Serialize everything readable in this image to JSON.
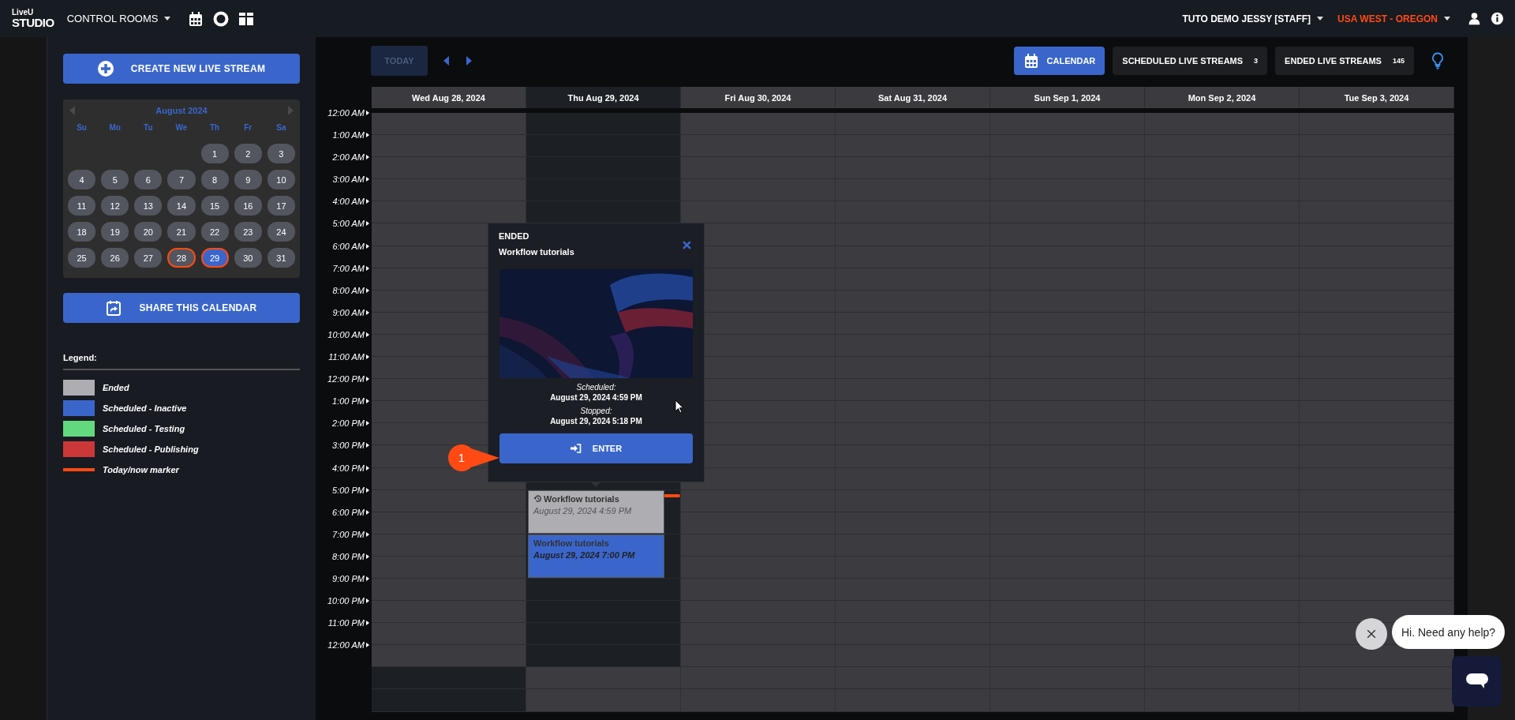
{
  "topbar": {
    "logo_top": "LiveU",
    "logo_bottom": "STUDIO",
    "menu": "CONTROL ROOMS",
    "user": "TUTO DEMO JESSY [STAFF]",
    "region": "USA WEST - OREGON"
  },
  "sidebar": {
    "create_button": "CREATE NEW LIVE STREAM",
    "mini_calendar": {
      "month": "August 2024",
      "weekdays": [
        "Su",
        "Mo",
        "Tu",
        "We",
        "Th",
        "Fr",
        "Sa"
      ],
      "weeks": [
        [
          {
            "label": "1",
            "selected": false,
            "outlined": false
          },
          {
            "label": "2",
            "selected": false,
            "outlined": false
          },
          {
            "label": "3",
            "selected": false,
            "outlined": false
          }
        ],
        [
          {
            "label": "4",
            "selected": false,
            "outlined": false
          },
          {
            "label": "5",
            "selected": false,
            "outlined": false
          },
          {
            "label": "6",
            "selected": false,
            "outlined": false
          },
          {
            "label": "7",
            "selected": false,
            "outlined": false
          },
          {
            "label": "8",
            "selected": false,
            "outlined": false
          },
          {
            "label": "9",
            "selected": false,
            "outlined": false
          },
          {
            "label": "10",
            "selected": false,
            "outlined": false
          }
        ],
        [
          {
            "label": "11",
            "selected": false,
            "outlined": false
          },
          {
            "label": "12",
            "selected": false,
            "outlined": false
          },
          {
            "label": "13",
            "selected": false,
            "outlined": false
          },
          {
            "label": "14",
            "selected": false,
            "outlined": false
          },
          {
            "label": "15",
            "selected": false,
            "outlined": false
          },
          {
            "label": "16",
            "selected": false,
            "outlined": false
          },
          {
            "label": "17",
            "selected": false,
            "outlined": false
          }
        ],
        [
          {
            "label": "18",
            "selected": false,
            "outlined": false
          },
          {
            "label": "19",
            "selected": false,
            "outlined": false
          },
          {
            "label": "20",
            "selected": false,
            "outlined": false
          },
          {
            "label": "21",
            "selected": false,
            "outlined": false
          },
          {
            "label": "22",
            "selected": false,
            "outlined": false
          },
          {
            "label": "23",
            "selected": false,
            "outlined": false
          },
          {
            "label": "24",
            "selected": false,
            "outlined": false
          }
        ],
        [
          {
            "label": "25",
            "selected": false,
            "outlined": false
          },
          {
            "label": "26",
            "selected": false,
            "outlined": false
          },
          {
            "label": "27",
            "selected": false,
            "outlined": false
          },
          {
            "label": "28",
            "selected": false,
            "outlined": true
          },
          {
            "label": "29",
            "selected": true,
            "outlined": true
          },
          {
            "label": "30",
            "selected": false,
            "outlined": false
          },
          {
            "label": "31",
            "selected": false,
            "outlined": false
          }
        ]
      ]
    },
    "share_button": "SHARE THIS CALENDAR",
    "legend": {
      "title": "Legend:",
      "items": [
        {
          "kind": "swatch",
          "color": "#aeadb2",
          "label": "Ended"
        },
        {
          "kind": "swatch",
          "color": "#3a66cc",
          "label": "Scheduled - Inactive"
        },
        {
          "kind": "swatch",
          "color": "#62d97f",
          "label": "Scheduled - Testing"
        },
        {
          "kind": "swatch",
          "color": "#cc383a",
          "label": "Scheduled - Publishing"
        },
        {
          "kind": "line",
          "color": "#ff4a14",
          "label": "Today/now marker"
        }
      ]
    }
  },
  "toolbar": {
    "today": {
      "label": "TODAY",
      "disabled": true
    },
    "views": [
      {
        "label": "CALENDAR",
        "selected": true
      },
      {
        "label": "SCHEDULED LIVE STREAMS",
        "count": "3",
        "selected": false
      },
      {
        "label": "ENDED LIVE STREAMS",
        "count": "145",
        "selected": false
      }
    ]
  },
  "calendar": {
    "days": [
      {
        "label": "Wed Aug 28, 2024",
        "selected": false
      },
      {
        "label": "Thu Aug 29, 2024",
        "selected": true
      },
      {
        "label": "Fri Aug 30, 2024",
        "selected": false
      },
      {
        "label": "Sat Aug 31, 2024",
        "selected": false
      },
      {
        "label": "Sun Sep 1, 2024",
        "selected": false
      },
      {
        "label": "Mon Sep 2, 2024",
        "selected": false
      },
      {
        "label": "Tue Sep 3, 2024",
        "selected": false
      }
    ],
    "times": [
      {
        "label": "12:00 AM",
        "now": false
      },
      {
        "label": "1:00 AM",
        "now": false
      },
      {
        "label": "2:00 AM",
        "now": false
      },
      {
        "label": "3:00 AM",
        "now": false
      },
      {
        "label": "4:00 AM",
        "now": false
      },
      {
        "label": "5:00 AM",
        "now": false
      },
      {
        "label": "6:00 AM",
        "now": false
      },
      {
        "label": "7:00 AM",
        "now": false
      },
      {
        "label": "8:00 AM",
        "now": false
      },
      {
        "label": "9:00 AM",
        "now": false
      },
      {
        "label": "10:00 AM",
        "now": false
      },
      {
        "label": "11:00 AM",
        "now": false
      },
      {
        "label": "12:00 PM",
        "now": false
      },
      {
        "label": "1:00 PM",
        "now": false
      },
      {
        "label": "2:00 PM",
        "now": false
      },
      {
        "label": "3:00 PM",
        "now": false
      },
      {
        "label": "4:00 PM",
        "now": false
      },
      {
        "label": "5:00 PM",
        "now": true,
        "events": [
          {
            "kind": "ended",
            "color": "#aeadb2",
            "title": "Workflow tutorials",
            "time": "August 29, 2024 4:59 PM"
          }
        ]
      },
      {
        "label": "6:00 PM",
        "now": false
      },
      {
        "label": "7:00 PM",
        "now": false,
        "events": [
          {
            "kind": "scheduled",
            "color": "#3a66cc",
            "title": "Workflow tutorials",
            "time": "August 29, 2024 7:00 PM"
          }
        ]
      },
      {
        "label": "8:00 PM",
        "now": false
      },
      {
        "label": "9:00 PM",
        "now": false
      },
      {
        "label": "10:00 PM",
        "now": false
      },
      {
        "label": "11:00 PM",
        "now": false
      },
      {
        "label": "12:00 AM",
        "now": false
      }
    ]
  },
  "popup": {
    "status": "ENDED",
    "title": "Workflow tutorials",
    "scheduled_label": "Scheduled:",
    "scheduled": "August 29, 2024 4:59 PM",
    "stopped_label": "Stopped:",
    "stopped": "August 29, 2024 5:18 PM",
    "button": "ENTER"
  },
  "callout": {
    "number": "1"
  },
  "chat": {
    "greeting": "Hi. Need any help?"
  }
}
